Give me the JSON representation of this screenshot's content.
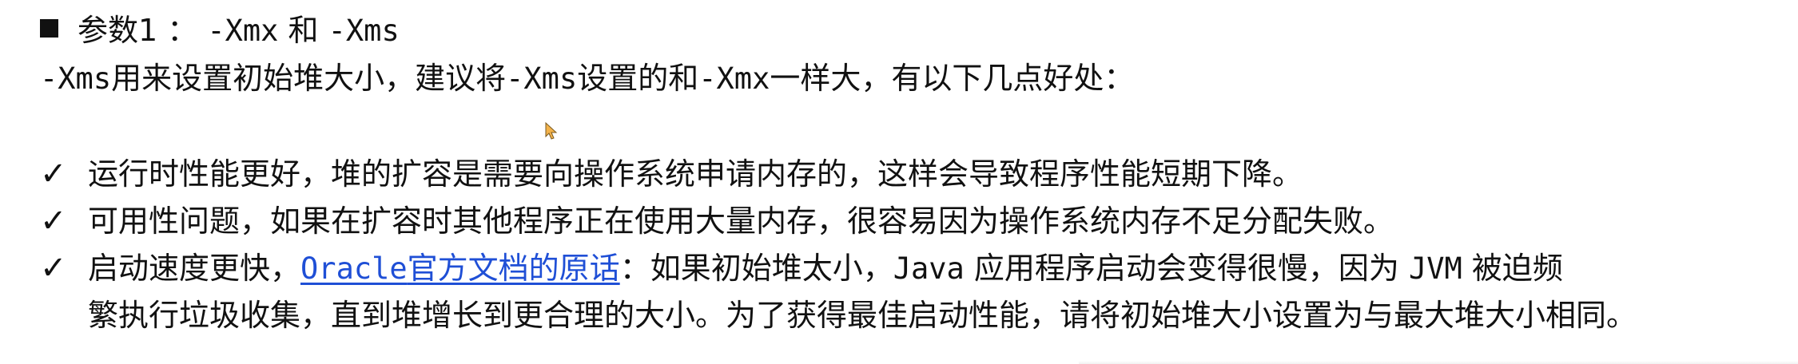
{
  "heading": {
    "prefix": "参数1 ： ",
    "xmx": "-Xmx",
    "and": " 和 ",
    "xms": "-Xms"
  },
  "intro": {
    "p1_code": "-Xms",
    "p2": "用来设置初始堆大小，建议将",
    "p3_code": "-Xms",
    "p4": "设置的和",
    "p5_code": "-Xmx",
    "p6": "一样大，有以下几点好处："
  },
  "bullets": {
    "b1": "运行时性能更好，堆的扩容是需要向操作系统申请内存的，这样会导致程序性能短期下降。",
    "b2": "可用性问题，如果在扩容时其他程序正在使用大量内存，很容易因为操作系统内存不足分配失败。",
    "b3": {
      "lead": "启动速度更快，",
      "link_code": "Oracle",
      "link_text": "官方文档的原话",
      "after_link": "：如果初始堆太小，",
      "java_code": "Java",
      "mid": " 应用程序启动会变得很慢，因为 ",
      "jvm_code": "JVM",
      "end_line1": " 被迫频",
      "line2": "繁执行垃圾收集，直到堆增长到更合理的大小。为了获得最佳启动性能，请将初始堆大小设置为与最大堆大小相同。"
    },
    "checkmark": "✓"
  },
  "icons": {
    "bullet_square": "square-bullet-icon",
    "checkmark": "checkmark-icon",
    "cursor": "mouse-pointer-icon"
  },
  "colors": {
    "text": "#111111",
    "link": "#1f4fd6",
    "cursor": "#f3b24a"
  }
}
